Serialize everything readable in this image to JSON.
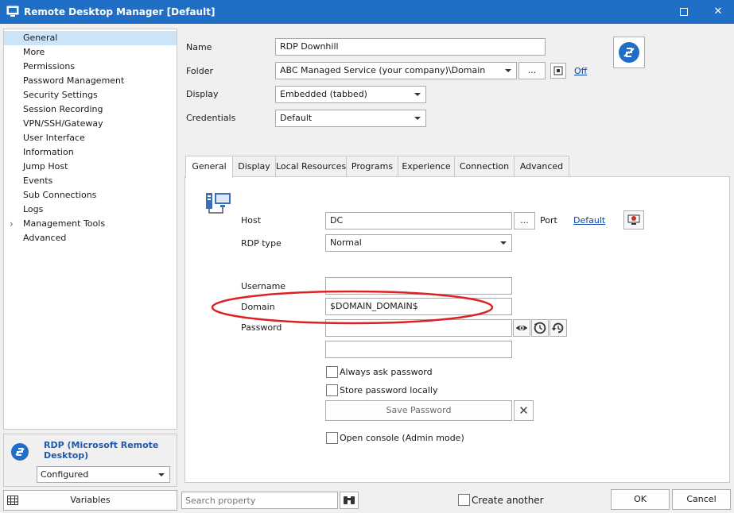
{
  "window": {
    "title": "Remote Desktop Manager [Default]",
    "minimize_glyph": "▫",
    "close_glyph": "✕"
  },
  "nav": {
    "items": [
      {
        "label": "General",
        "selected": true
      },
      {
        "label": "More"
      },
      {
        "label": "Permissions"
      },
      {
        "label": "Password Management"
      },
      {
        "label": "Security Settings"
      },
      {
        "label": "Session Recording"
      },
      {
        "label": "VPN/SSH/Gateway"
      },
      {
        "label": "User Interface"
      },
      {
        "label": "Information"
      },
      {
        "label": "Jump Host"
      },
      {
        "label": "Events"
      },
      {
        "label": "Sub Connections"
      },
      {
        "label": "Logs"
      },
      {
        "label": "Management Tools",
        "expandable": true
      },
      {
        "label": "Advanced"
      }
    ],
    "expander_glyph": "›"
  },
  "entry_type": {
    "title": "RDP (Microsoft Remote Desktop)",
    "status": "Configured"
  },
  "form": {
    "name_label": "Name",
    "name_value": "RDP Downhill",
    "folder_label": "Folder",
    "folder_value": "ABC Managed Service (your company)\\Domain",
    "folder_browse": "...",
    "folder_link": "Off",
    "display_label": "Display",
    "display_value": "Embedded (tabbed)",
    "credentials_label": "Credentials",
    "credentials_value": "Default"
  },
  "tabs": [
    {
      "label": "General",
      "active": true
    },
    {
      "label": "Display"
    },
    {
      "label": "Local Resources"
    },
    {
      "label": "Programs"
    },
    {
      "label": "Experience"
    },
    {
      "label": "Connection"
    },
    {
      "label": "Advanced"
    }
  ],
  "general": {
    "host_label": "Host",
    "host_value": "DC",
    "host_browse": "...",
    "port_label": "Port",
    "port_link": "Default",
    "rdp_type_label": "RDP type",
    "rdp_type_value": "Normal",
    "username_label": "Username",
    "username_value": "",
    "domain_label": "Domain",
    "domain_value": "$DOMAIN_DOMAIN$",
    "password_label": "Password",
    "password_value": "",
    "password_confirm_value": "",
    "always_ask_label": "Always ask password",
    "store_locally_label": "Store password locally",
    "save_password_label": "Save Password",
    "open_console_label": "Open console (Admin mode)"
  },
  "annotation": {
    "color": "#e02020"
  },
  "bottom": {
    "variables_label": "Variables",
    "search_placeholder": "Search property",
    "create_another_label": "Create another",
    "ok_label": "OK",
    "cancel_label": "Cancel"
  },
  "colors": {
    "titlebar": "#1f6fc6",
    "accent": "#1f5aa8",
    "selection": "#cce4f7"
  }
}
